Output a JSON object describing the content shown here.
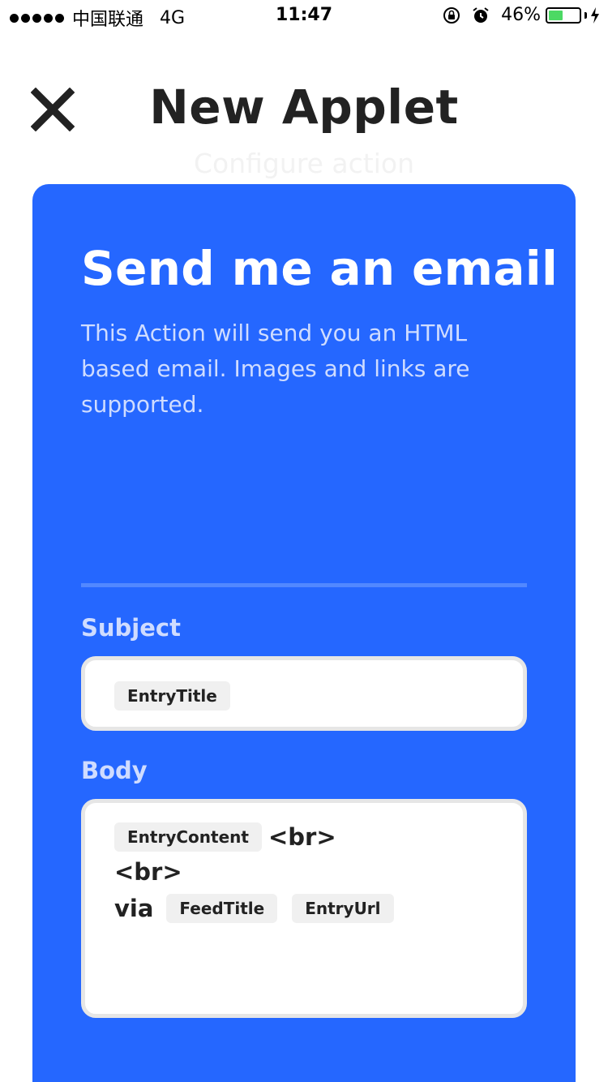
{
  "status_bar": {
    "carrier": "中国联通",
    "network": "4G",
    "time": "11:47",
    "battery_percent": "46%",
    "battery_level": 0.46,
    "battery_color": "#4cd964"
  },
  "header": {
    "title": "New Applet",
    "subtitle": "Configure action",
    "close_icon": "close-icon"
  },
  "card": {
    "color": "#2567ff",
    "title": "Send me an email",
    "description": "This Action will send you an HTML based email. Images and links are supported."
  },
  "subject": {
    "label": "Subject",
    "ingredients": [
      "EntryTitle"
    ]
  },
  "body": {
    "label": "Body",
    "line1_ingredient": "EntryContent",
    "line1_text": "<br>",
    "line2_text": "<br>",
    "line3_text": "via",
    "line3_ingredients": [
      "FeedTitle",
      "EntryUrl"
    ]
  }
}
